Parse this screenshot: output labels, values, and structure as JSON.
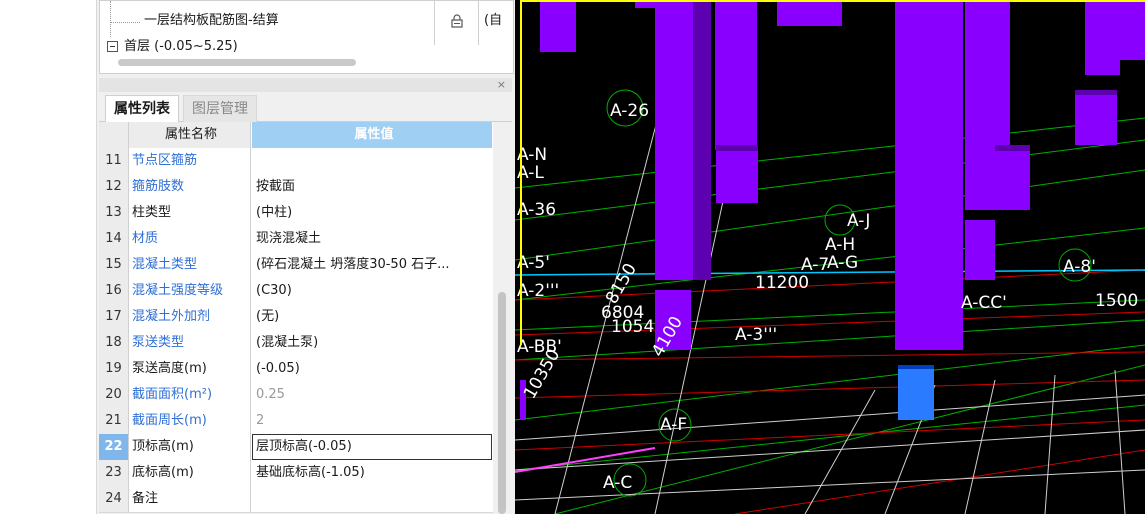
{
  "tree": {
    "rows": [
      {
        "label": "一层结构板配筋图-结算",
        "col3": "(自"
      },
      {
        "label": "首层 (-0.05~5.25)"
      }
    ]
  },
  "props": {
    "tabs": [
      "属性列表",
      "图层管理"
    ],
    "close": "×",
    "header": {
      "name": "属性名称",
      "value": "属性值"
    },
    "rows": [
      {
        "num": "11",
        "name": "节点区箍筋",
        "value": "",
        "style": "blue"
      },
      {
        "num": "12",
        "name": "箍筋肢数",
        "value": "按截面",
        "style": "blue"
      },
      {
        "num": "13",
        "name": "柱类型",
        "value": "(中柱)",
        "style": "normal"
      },
      {
        "num": "14",
        "name": "材质",
        "value": "现浇混凝土",
        "style": "blue"
      },
      {
        "num": "15",
        "name": "混凝土类型",
        "value": "(碎石混凝土 坍落度30-50 石子...",
        "style": "blue"
      },
      {
        "num": "16",
        "name": "混凝土强度等级",
        "value": "(C30)",
        "style": "blue"
      },
      {
        "num": "17",
        "name": "混凝土外加剂",
        "value": "(无)",
        "style": "blue"
      },
      {
        "num": "18",
        "name": "泵送类型",
        "value": "(混凝土泵)",
        "style": "blue"
      },
      {
        "num": "19",
        "name": "泵送高度(m)",
        "value": "(-0.05)",
        "style": "normal"
      },
      {
        "num": "20",
        "name": "截面面积(m²)",
        "value": "0.25",
        "style": "gray"
      },
      {
        "num": "21",
        "name": "截面周长(m)",
        "value": "2",
        "style": "gray"
      },
      {
        "num": "22",
        "name": "顶标高(m)",
        "value": "层顶标高(-0.05)",
        "style": "selected"
      },
      {
        "num": "23",
        "name": "底标高(m)",
        "value": "基础底标高(-1.05)",
        "style": "normal"
      },
      {
        "num": "24",
        "name": "备注",
        "value": "",
        "style": "normal"
      }
    ]
  },
  "cad": {
    "labels": [
      "A-26",
      "A-N",
      "A-L",
      "A-36",
      "A-J",
      "A-H",
      "A-G",
      "A-7",
      "A-5'",
      "A-2'''",
      "A-BB'",
      "A-F",
      "A-C",
      "A-3'''",
      "A-CC'",
      "A-8'",
      "11200",
      "1500",
      "10350",
      "8150",
      "6804",
      "1054",
      "4100"
    ],
    "colors": {
      "column": "#8a00ff",
      "column_dark": "#5c00b0",
      "selected_column": "#2a7bff",
      "grid_green": "#00b000",
      "grid_red": "#d00000",
      "grid_cyan": "#00c8ff",
      "frame": "#ffff00"
    }
  }
}
